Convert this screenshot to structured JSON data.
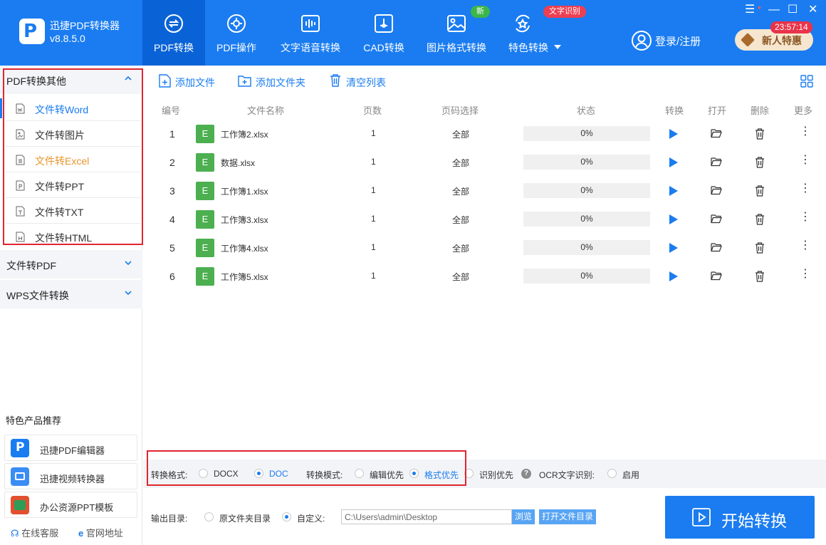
{
  "app": {
    "title": "迅捷PDF转换器",
    "version": "v8.8.5.0"
  },
  "nav": {
    "tabs": [
      {
        "label": "PDF转换",
        "icon": "convert-icon",
        "active": true
      },
      {
        "label": "PDF操作",
        "icon": "gear-icon"
      },
      {
        "label": "文字语音转换",
        "icon": "waveform-icon"
      },
      {
        "label": "CAD转换",
        "icon": "cad-icon"
      },
      {
        "label": "图片格式转换",
        "icon": "image-icon",
        "badge": "新"
      },
      {
        "label": "特色转换",
        "icon": "star-refresh-icon",
        "badge": "文字识别"
      }
    ],
    "login": "登录/注册",
    "clock": "23:57:14",
    "promo": "新人特惠"
  },
  "sidebar": {
    "section1": "PDF转换其他",
    "items": [
      "文件转Word",
      "文件转图片",
      "文件转Excel",
      "文件转PPT",
      "文件转TXT",
      "文件转HTML"
    ],
    "section2": "文件转PDF",
    "section3": "WPS文件转换",
    "featured_title": "特色产品推荐",
    "featured": [
      "迅捷PDF编辑器",
      "迅捷视频转换器",
      "办公资源PPT模板"
    ],
    "footer": {
      "service": "在线客服",
      "site": "官网地址"
    }
  },
  "toolbar": {
    "add_file": "添加文件",
    "add_folder": "添加文件夹",
    "clear": "清空列表"
  },
  "table": {
    "headers": [
      "编号",
      "文件名称",
      "页数",
      "页码选择",
      "状态",
      "转换",
      "打开",
      "删除",
      "更多"
    ],
    "rows": [
      {
        "num": "1",
        "icon_letter": "E",
        "name": "工作簿2.xlsx",
        "pages": "1",
        "range": "全部",
        "progress": 0,
        "status": "0%"
      },
      {
        "num": "2",
        "icon_letter": "E",
        "name": "数据.xlsx",
        "pages": "1",
        "range": "全部",
        "progress": 0,
        "status": "0%"
      },
      {
        "num": "3",
        "icon_letter": "E",
        "name": "工作簿1.xlsx",
        "pages": "1",
        "range": "全部",
        "progress": 0,
        "status": "0%"
      },
      {
        "num": "4",
        "icon_letter": "E",
        "name": "工作簿3.xlsx",
        "pages": "1",
        "range": "全部",
        "progress": 0,
        "status": "0%"
      },
      {
        "num": "5",
        "icon_letter": "E",
        "name": "工作簿4.xlsx",
        "pages": "1",
        "range": "全部",
        "progress": 0,
        "status": "0%"
      },
      {
        "num": "6",
        "icon_letter": "E",
        "name": "工作簿5.xlsx",
        "pages": "1",
        "range": "全部",
        "progress": 0,
        "status": "0%"
      }
    ]
  },
  "options": {
    "format_label": "转换格式:",
    "formats": [
      "DOCX",
      "DOC"
    ],
    "selected_format": "DOC",
    "mode_label": "转换模式:",
    "modes": [
      "编辑优先",
      "格式优先",
      "识别优先"
    ],
    "selected_mode": "格式优先",
    "ocr_label": "OCR文字识别:",
    "ocr_enable": "启用"
  },
  "output": {
    "label": "输出目录:",
    "original": "原文件夹目录",
    "custom": "自定义:",
    "path": "C:\\Users\\admin\\Desktop",
    "browse": "浏览",
    "open_dir": "打开文件目录"
  },
  "start_button": "开始转换",
  "colors": {
    "primary": "#1a7cf0",
    "active_tab": "#0a63d6",
    "excel": "#4caf50",
    "highlight": "#e0262f",
    "orange_item": "#e8952b"
  }
}
